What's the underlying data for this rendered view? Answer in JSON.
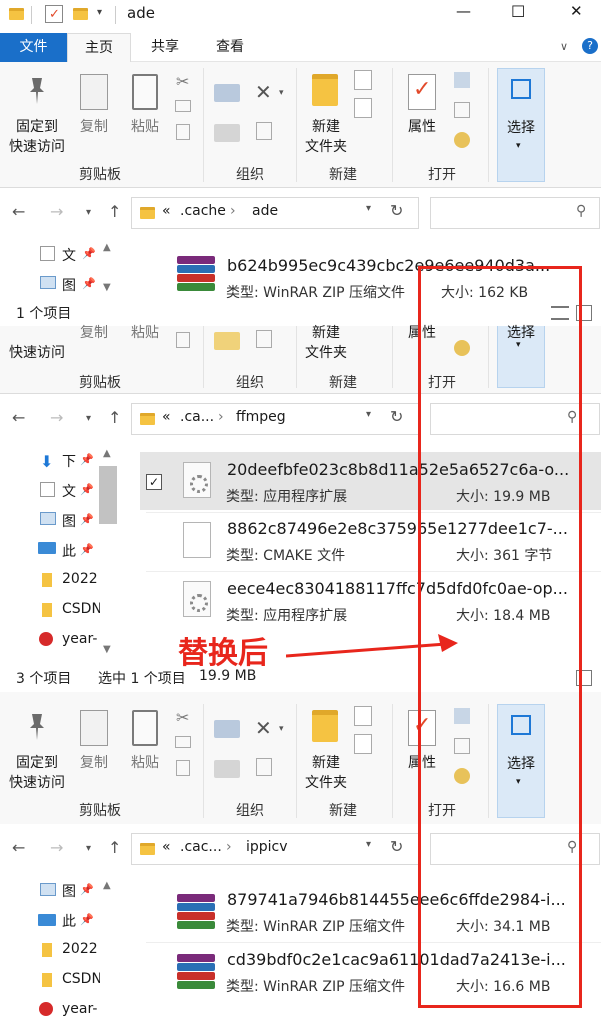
{
  "window": {
    "title": "ade",
    "controls": {
      "minimize": "—",
      "maximize": "☐",
      "close": "✕"
    }
  },
  "ribbon_tabs": {
    "file": "文件",
    "home": "主页",
    "share": "共享",
    "view": "查看"
  },
  "ribbon": {
    "pin": {
      "line1": "固定到",
      "line2": "快速访问"
    },
    "copy": "复制",
    "paste": "粘贴",
    "new_folder": {
      "line1": "新建",
      "line2": "文件夹"
    },
    "properties": "属性",
    "select": "选择",
    "groups": {
      "clipboard": "剪贴板",
      "organize": "组织",
      "new": "新建",
      "open": "打开"
    }
  },
  "windows": [
    {
      "path": {
        "prefix": "«",
        "parent": ".cache",
        "sep": "›",
        "current": "ade"
      },
      "sidebar": [
        {
          "label": "文"
        },
        {
          "label": "图"
        }
      ],
      "files": [
        {
          "name": "b624b995ec9c439cbc2e9e6ee940d3a...",
          "type": "类型: WinRAR ZIP 压缩文件",
          "size": "大小: 162 KB",
          "icon": "winrar-icon"
        }
      ],
      "status": {
        "count": "1 个项目"
      }
    },
    {
      "path": {
        "prefix": "«",
        "parent": ".ca...",
        "sep": "›",
        "current": "ffmpeg"
      },
      "sidebar": [
        {
          "label": "下"
        },
        {
          "label": "文"
        },
        {
          "label": "图"
        },
        {
          "label": "此"
        },
        {
          "label": "2022"
        },
        {
          "label": "CSDN"
        },
        {
          "label": "year-"
        }
      ],
      "files": [
        {
          "name": "20deefbfe023c8b8d11a52e5a6527c6a-o...",
          "type": "类型: 应用程序扩展",
          "size": "大小: 19.9 MB",
          "icon": "dll-gear-icon"
        },
        {
          "name": "8862c87496e2e8c375965e1277dee1c7-...",
          "type": "类型: CMAKE 文件",
          "size": "大小: 361 字节",
          "icon": "blank-file-icon"
        },
        {
          "name": "eece4ec8304188117ffc7d5dfd0fc0ae-op...",
          "type": "类型: 应用程序扩展",
          "size": "大小: 18.4 MB",
          "icon": "dll-gear-icon"
        }
      ],
      "status": {
        "count": "3 个项目",
        "selected": "选中 1 个项目",
        "sel_size": "19.9 MB"
      }
    },
    {
      "path": {
        "prefix": "«",
        "parent": ".cac...",
        "sep": "›",
        "current": "ippicv"
      },
      "sidebar": [
        {
          "label": "图"
        },
        {
          "label": "此"
        },
        {
          "label": "2022"
        },
        {
          "label": "CSDN"
        },
        {
          "label": "year-"
        }
      ],
      "files": [
        {
          "name": "879741a7946b814455eee6c6ffde2984-i...",
          "type": "类型: WinRAR ZIP 压缩文件",
          "size": "大小: 34.1 MB",
          "icon": "winrar-icon"
        },
        {
          "name": "cd39bdf0c2e1cac9a61101dad7a2413e-i...",
          "type": "类型: WinRAR ZIP 压缩文件",
          "size": "大小: 16.6 MB",
          "icon": "winrar-icon"
        }
      ]
    }
  ],
  "annotation": {
    "text": "替换后",
    "color": "#e8261c"
  }
}
